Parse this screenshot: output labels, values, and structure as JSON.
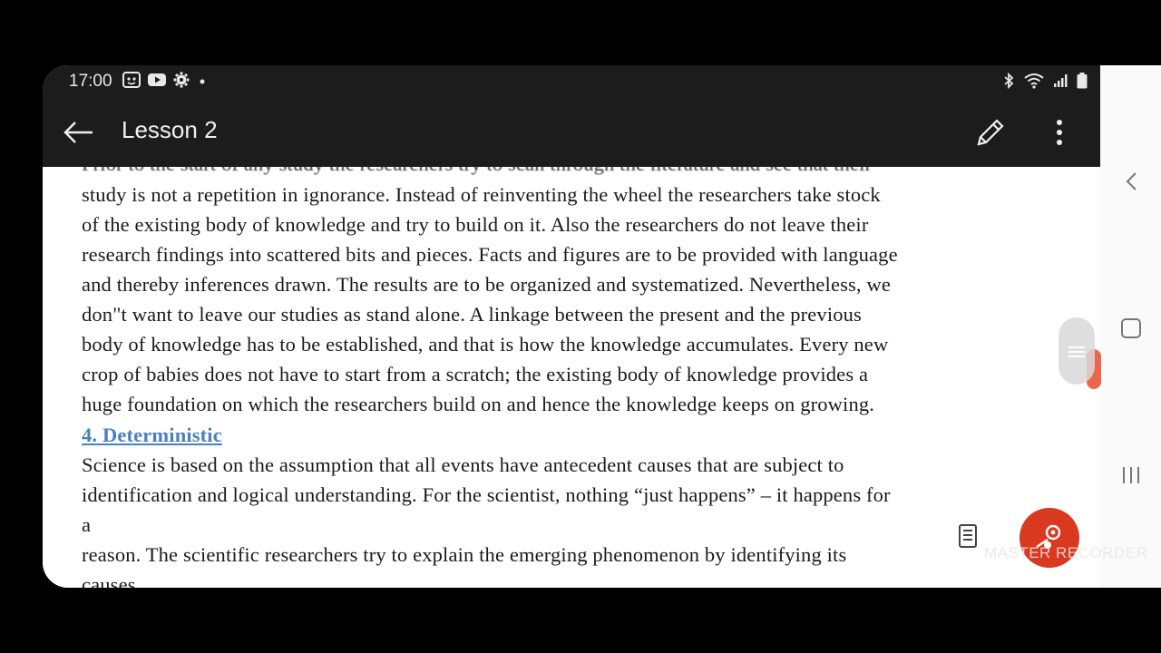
{
  "status_bar": {
    "time": "17:00",
    "left_icons": [
      "face-icon",
      "youtube-icon",
      "gear-icon",
      "dot-icon"
    ],
    "right_icons": [
      "bluetooth-icon",
      "wifi-icon",
      "signal-icon",
      "battery-icon"
    ]
  },
  "app_bar": {
    "title": "Lesson 2",
    "back_icon": "arrow-left-icon",
    "edit_icon": "pencil-icon",
    "more_icon": "more-vertical-icon"
  },
  "document": {
    "cut_line": "Prior to the start of any study the researchers try to scan through the literature and see that their",
    "para1": [
      "study is not a repetition in ignorance. Instead of reinventing the wheel the researchers take stock",
      "of the existing body of knowledge and try to build on it. Also the researchers do not leave their",
      "research findings into scattered bits and pieces. Facts and figures are to be provided with language",
      "and thereby inferences drawn. The results are to be organized and systematized. Nevertheless, we",
      "don\"t want to leave our studies as stand alone. A linkage between the present and the previous",
      "body of knowledge has to be established, and that is how the knowledge accumulates. Every new",
      "crop of babies does not have to start from a scratch; the existing body of knowledge provides a",
      "huge foundation on which the researchers build on and hence the knowledge keeps on growing."
    ],
    "heading": "4. Deterministic",
    "para2": [
      "Science is based on the assumption that all events have antecedent causes that are subject to",
      "identification and logical understanding. For the scientist, nothing “just happens” – it happens for",
      "a",
      "reason. The scientific researchers try to explain the emerging phenomenon by identifying its",
      "causes."
    ]
  },
  "overlay": {
    "watermark": "MASTER RECORDER",
    "reader_icon": "document-reader-icon",
    "recorder_icon": "screen-recorder-icon"
  },
  "nav": {
    "back_icon": "chevron-left-icon",
    "home_icon": "square-home-icon",
    "recents_icon": "recents-icon"
  },
  "colors": {
    "app_bar": "#1c1c1c",
    "heading_link": "#4a7fc1",
    "recorder": "#d8391f"
  }
}
